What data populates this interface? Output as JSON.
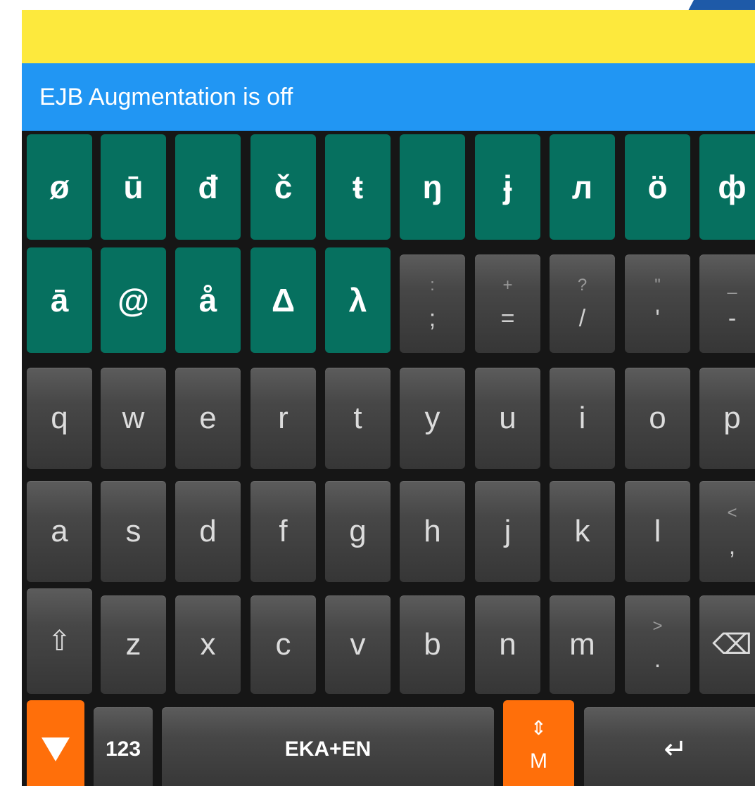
{
  "status": {
    "text": "EJB Augmentation is off"
  },
  "colors": {
    "suggestion_bar": "#fde93d",
    "status_bar": "#2196f3",
    "special_key": "#06705f",
    "letter_key": "#474747",
    "accent_key": "#ff6f0a",
    "keyboard_background": "#161616"
  },
  "keyboard": {
    "special_row_1": [
      "ø",
      "ū",
      "đ",
      "č",
      "ŧ",
      "ŋ",
      "ɉ",
      "л",
      "ö",
      "ф"
    ],
    "special_row_2": [
      "ā",
      "@",
      "å",
      "Δ",
      "λ"
    ],
    "punct_row_2": [
      {
        "top": ":",
        "bottom": ";"
      },
      {
        "top": "+",
        "bottom": "="
      },
      {
        "top": "?",
        "bottom": "/"
      },
      {
        "top": "\"",
        "bottom": "'"
      },
      {
        "top": "_",
        "bottom": "-"
      }
    ],
    "row_q": [
      "q",
      "w",
      "e",
      "r",
      "t",
      "y",
      "u",
      "i",
      "o",
      "p"
    ],
    "row_a": [
      "a",
      "s",
      "d",
      "f",
      "g",
      "h",
      "j",
      "k",
      "l"
    ],
    "comma_key": {
      "top": "<",
      "bottom": ","
    },
    "shift_symbol": "⇧",
    "row_z": [
      "z",
      "x",
      "c",
      "v",
      "b",
      "n",
      "m"
    ],
    "period_key": {
      "top": ">",
      "bottom": "."
    },
    "backspace_symbol": "⌫",
    "bottom": {
      "hide_icon": "triangle-down-icon",
      "numbers_label": "123",
      "space_label": "EKA+EN",
      "mode_arrow": "⇕",
      "mode_label": "M",
      "enter_symbol": "↵"
    }
  }
}
